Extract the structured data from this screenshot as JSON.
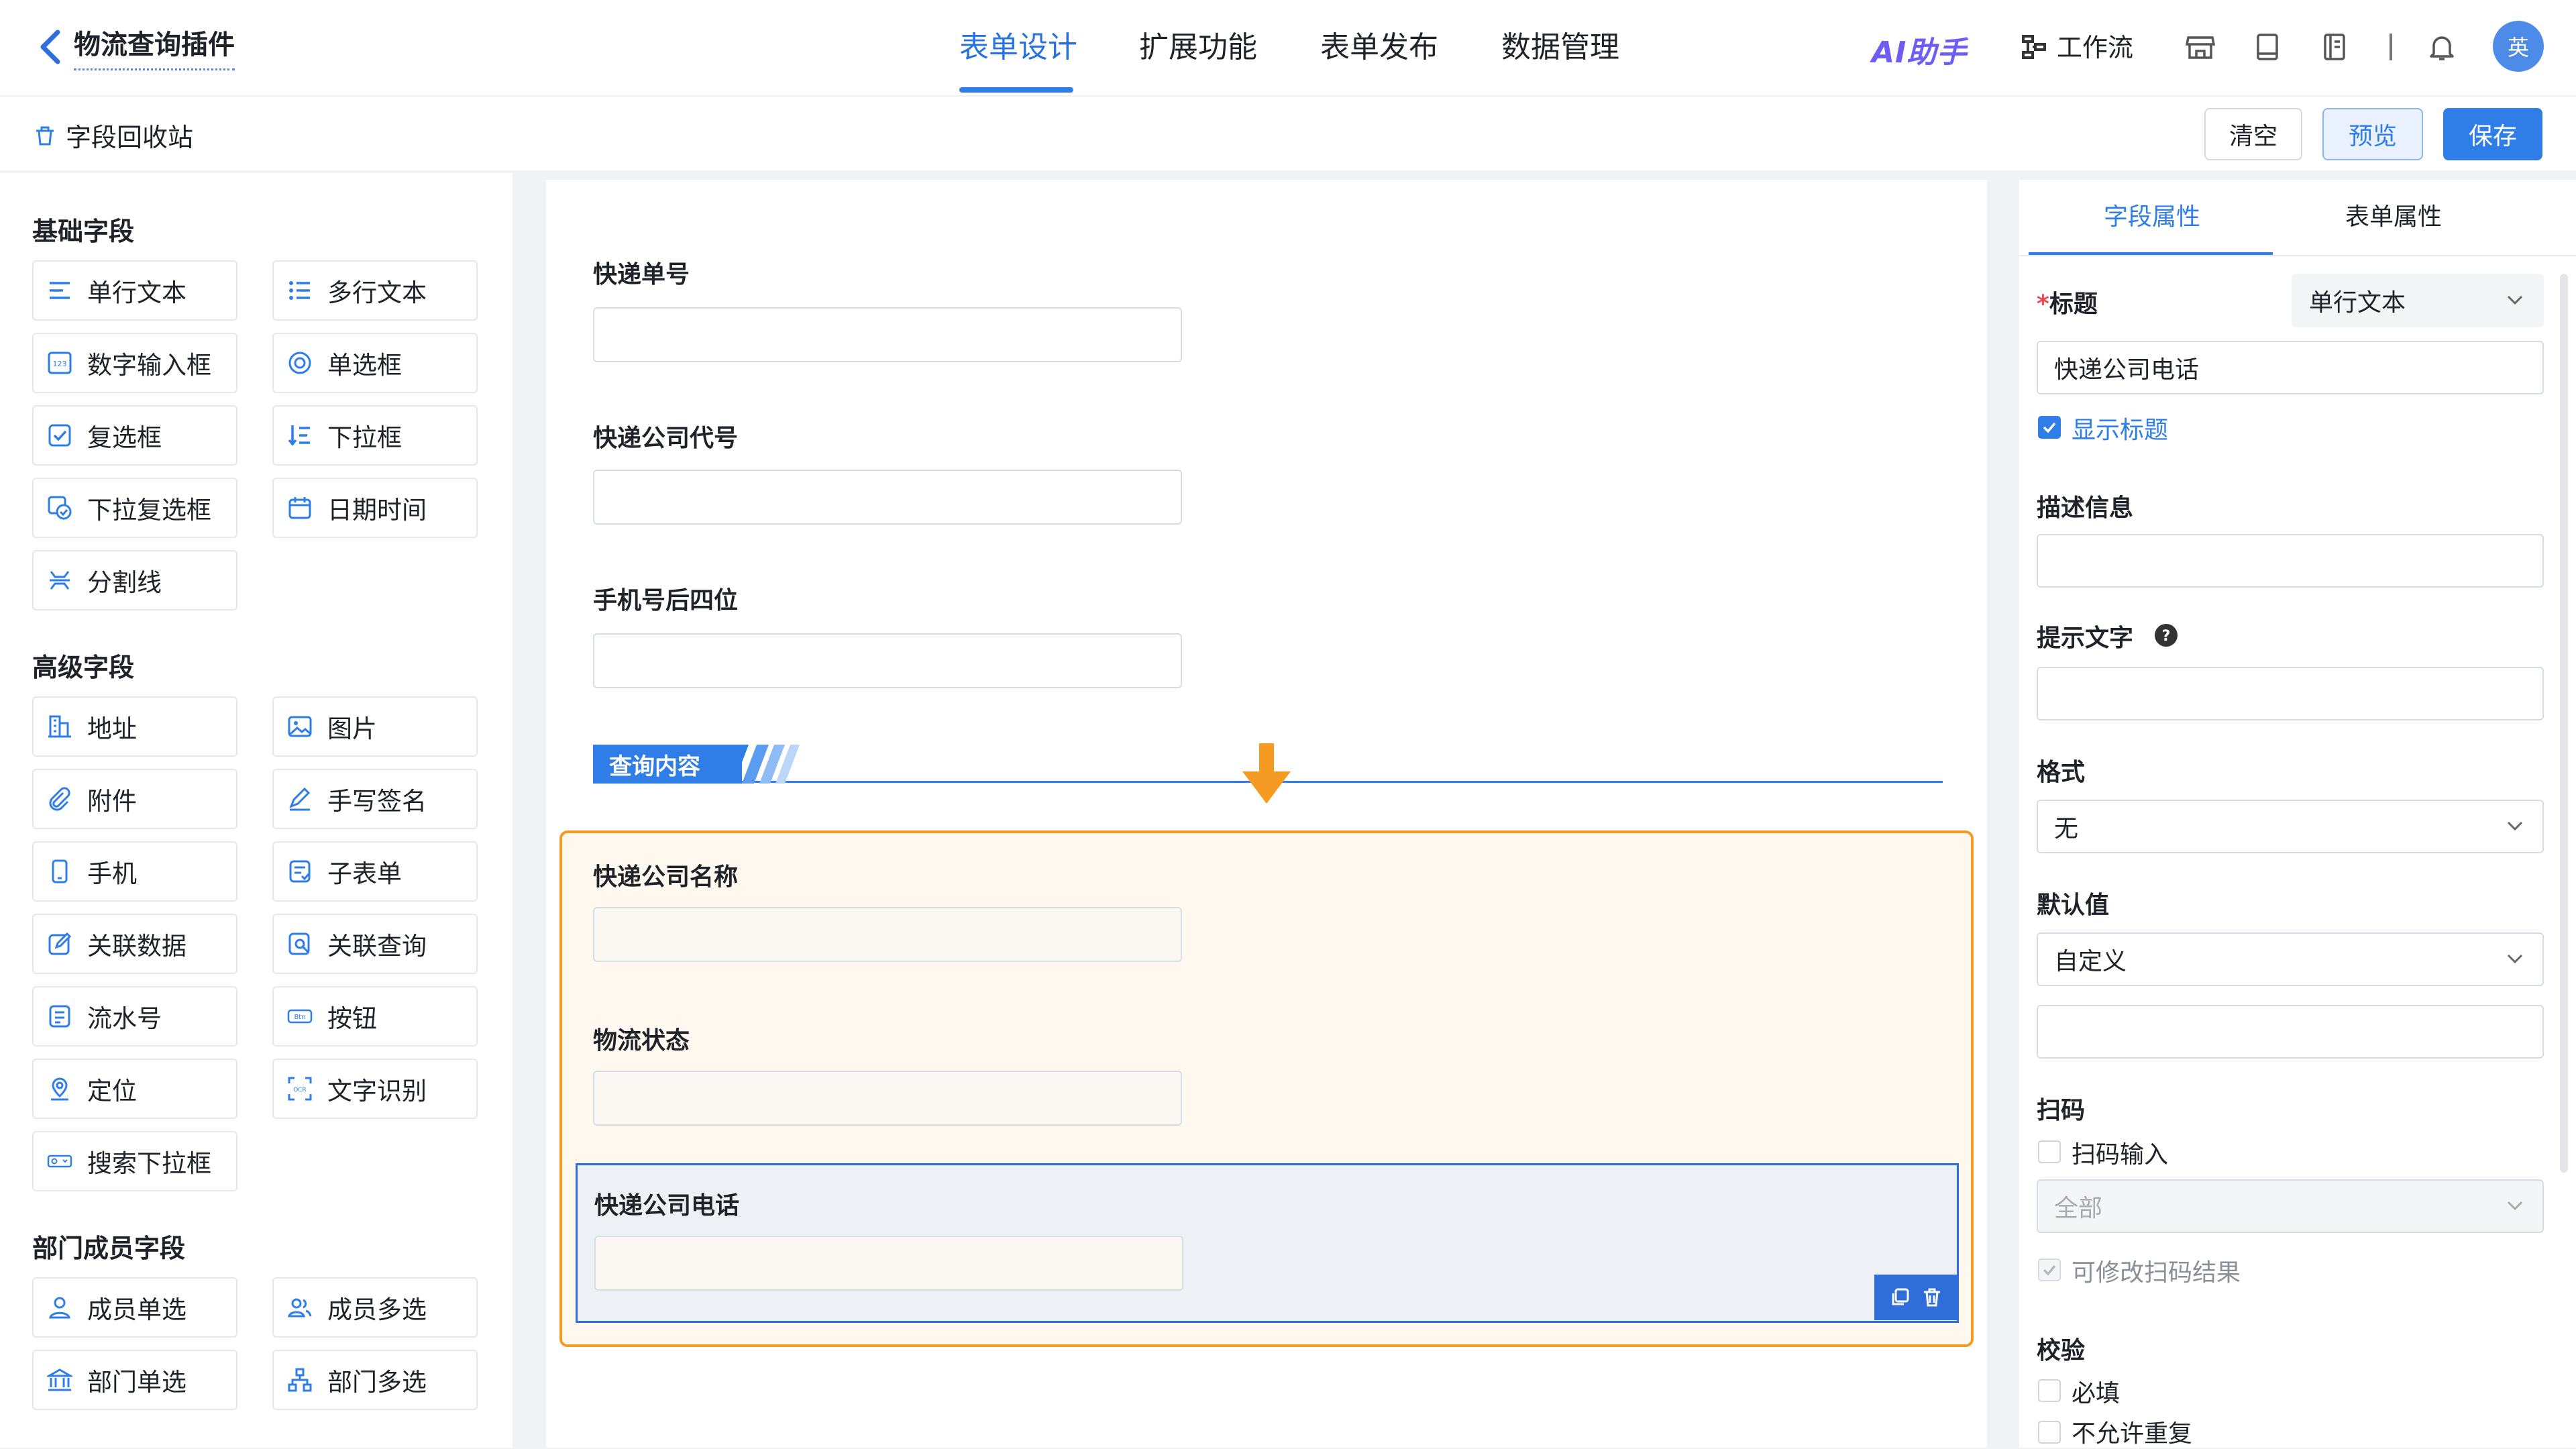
{
  "header": {
    "app_title": "物流查询插件",
    "tabs": [
      {
        "label": "表单设计",
        "active": true
      },
      {
        "label": "扩展功能",
        "active": false
      },
      {
        "label": "表单发布",
        "active": false
      },
      {
        "label": "数据管理",
        "active": false
      }
    ],
    "ai_label": "AI助手",
    "workflow_label": "工作流",
    "avatar_text": "英",
    "accent": "#2f7de6"
  },
  "toolbar": {
    "recycle_label": "字段回收站",
    "clear_label": "清空",
    "preview_label": "预览",
    "save_label": "保存"
  },
  "palette": {
    "basic_title": "基础字段",
    "basic": [
      "单行文本",
      "多行文本",
      "数字输入框",
      "单选框",
      "复选框",
      "下拉框",
      "下拉复选框",
      "日期时间",
      "分割线"
    ],
    "advanced_title": "高级字段",
    "advanced": [
      "地址",
      "图片",
      "附件",
      "手写签名",
      "手机",
      "子表单",
      "关联数据",
      "关联查询",
      "流水号",
      "按钮",
      "定位",
      "文字识别",
      "搜索下拉框"
    ],
    "member_title": "部门成员字段",
    "member": [
      "成员单选",
      "成员多选",
      "部门单选",
      "部门多选"
    ]
  },
  "canvas": {
    "fields": [
      "快递单号",
      "快递公司代号",
      "手机号后四位"
    ],
    "section_title": "查询内容",
    "group_fields": [
      "快递公司名称",
      "物流状态"
    ],
    "selected_field": "快递公司电话"
  },
  "props": {
    "tab_field": "字段属性",
    "tab_form": "表单属性",
    "title_label": "标题",
    "required_mark": "*",
    "title_type": "单行文本",
    "title_value": "快递公司电话",
    "show_title_label": "显示标题",
    "show_title_checked": true,
    "desc_label": "描述信息",
    "hint_label": "提示文字",
    "format_label": "格式",
    "format_value": "无",
    "default_label": "默认值",
    "default_value": "自定义",
    "scan_label": "扫码",
    "scan_input_label": "扫码输入",
    "scan_scope": "全部",
    "scan_edit_label": "可修改扫码结果",
    "validate_label": "校验",
    "required_label": "必填",
    "no_repeat_label": "不允许重复"
  }
}
